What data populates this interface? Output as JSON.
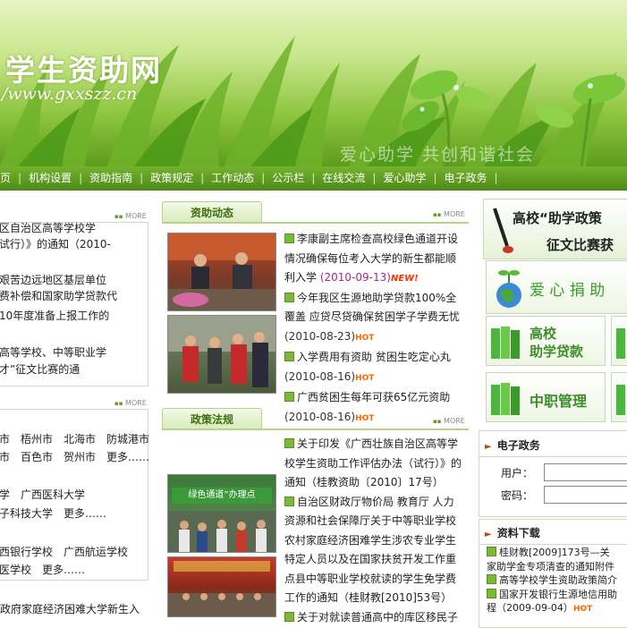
{
  "banner": {
    "title": "学生资助网",
    "url": "/www.gxxszz.cn",
    "slogan": "爱心助学 共创和谐社会"
  },
  "nav": {
    "items": [
      "页",
      "机构设置",
      "资助指南",
      "政策规定",
      "工作动态",
      "公示栏",
      "在线交流",
      "爱心助学",
      "电子政务"
    ],
    "trailing_sep": "|"
  },
  "more_label": "MORE",
  "left": {
    "block1": [
      "区自治区高等学校学",
      "试行）》的通知（2010-",
      "",
      "艰苦边远地区基层单位",
      "费补偿和国家助学贷款代",
      "10年度准备上报工作的",
      "",
      "高等学校、中等职业学",
      "才”征文比赛的通"
    ],
    "block2": [
      "市　梧州市　北海市　防城港市",
      "市　百色市　贺州市　更多……",
      "",
      "学　广西医科大学",
      "子科技大学　更多……",
      "",
      "西银行学校　广西航运学校",
      "医学校　更多……"
    ],
    "block3": "政府家庭经济困难大学新生入"
  },
  "middle": {
    "tab1": "资助动态",
    "news1": [
      {
        "text": "李康副主席检查高校绿色通道开设情况确保每位考入大学的新生都能顺利入学",
        "date": "(2010-09-13)",
        "badge": "NEW!"
      },
      {
        "text": "今年我区生源地助学贷款100%全覆盖 应贷尽贷确保贫困学子学费无忧",
        "date": "(2010-08-23)",
        "badge": "HOT"
      },
      {
        "text": "入学费用有资助 贫困生吃定心丸",
        "date": "(2010-08-16)",
        "badge": "HOT"
      },
      {
        "text": "广西贫困生每年可获65亿元资助",
        "date": "(2010-08-16)",
        "badge": "HOT"
      }
    ],
    "tab2": "政策法规",
    "news2": [
      {
        "text": "关于印发《广西壮族自治区高等学校学生资助工作评估办法（试行）》的通知（桂教资助〔2010〕17号）"
      },
      {
        "text": "自治区财政厅物价局 教育厅 人力资源和社会保障厅关于中等职业学校农村家庭经济困难学生涉农专业学生特定人员以及在国家扶贫开发工作重点县中等职业学校就读的学生免学费工作的通知（桂财教[2010]53号）"
      },
      {
        "text": "关于对就读普通高中的库区移民子"
      }
    ],
    "photo2_caption": "绿色通道”办理点"
  },
  "right": {
    "essay_banner_line1": "高校“助学政策",
    "essay_banner_line2": "征文比赛获",
    "love_banner": "爱 心 捐 助",
    "tile_loan_line1": "高校",
    "tile_loan_line2": "助学贷款",
    "tile_vocational": "中职管理",
    "egov_title": "电子政务",
    "user_label": "用户：",
    "pass_label": "密码：",
    "download_title": "资料下载",
    "downloads": [
      {
        "text": "桂财教[2009]173号—关",
        "cont": "家助学金专项清查的通知附件"
      },
      {
        "text": "高等学校学生资助政策简介"
      },
      {
        "text": "国家开发银行生源地信用助",
        "cont": "程（2009-09-04）",
        "badge": "HOT"
      }
    ]
  },
  "colors": {
    "nav_bg": "#5e9c20",
    "tab_text": "#3b6e0c",
    "date": "#9a2d8c",
    "hot": "#ff6600"
  }
}
